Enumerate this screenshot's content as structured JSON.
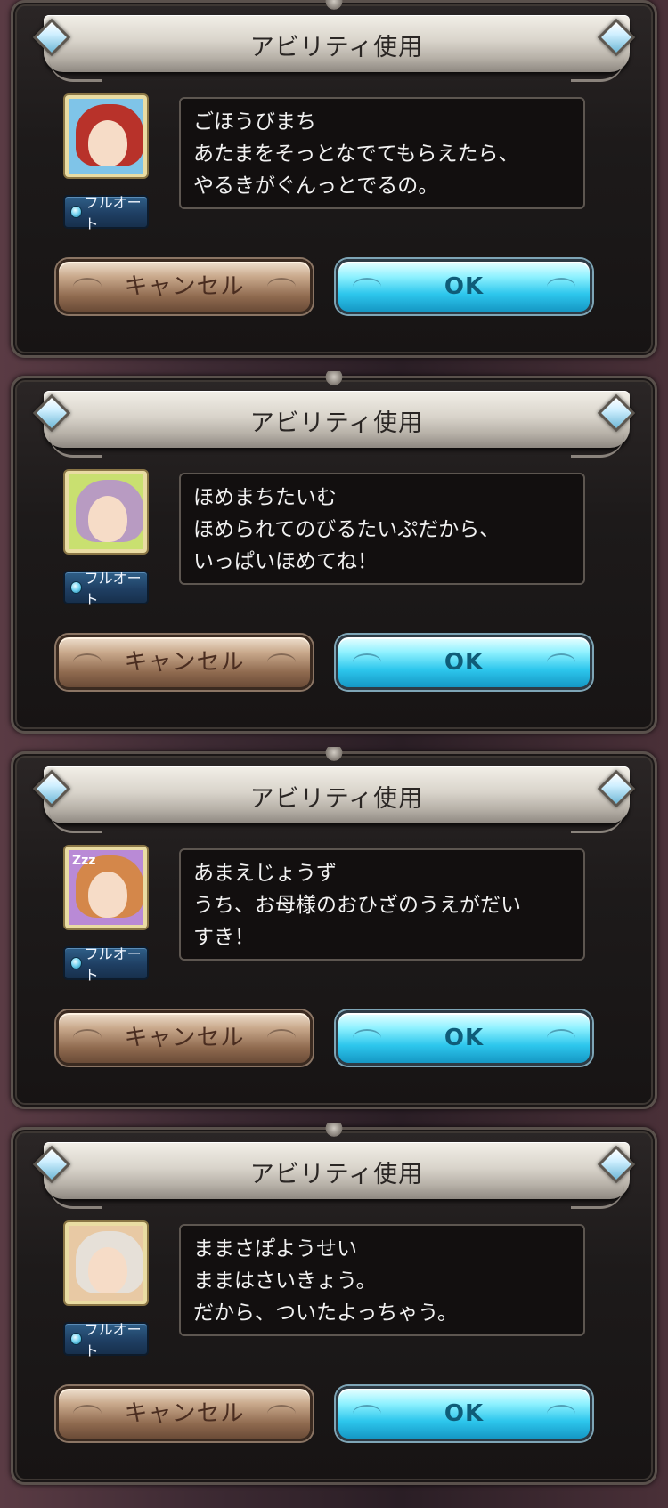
{
  "dialogs": [
    {
      "title": "アビリティ使用",
      "full_auto_label": "フルオート",
      "message_lines": [
        "ごほうびまち",
        "あたまをそっとなでてもらえたら、",
        "やるきがぐんっとでるの。"
      ],
      "cancel_label": "キャンセル",
      "ok_label": "OK",
      "avatar_bubble": "",
      "avatar_colors": {
        "bg": "#7fc4e8",
        "hair": "#b8322a"
      }
    },
    {
      "title": "アビリティ使用",
      "full_auto_label": "フルオート",
      "message_lines": [
        "ほめまちたいむ",
        "ほめられてのびるたいぷだから、",
        "いっぱいほめてね！"
      ],
      "cancel_label": "キャンセル",
      "ok_label": "OK",
      "avatar_bubble": "",
      "avatar_colors": {
        "bg": "#c9e070",
        "hair": "#b89bc2"
      }
    },
    {
      "title": "アビリティ使用",
      "full_auto_label": "フルオート",
      "message_lines": [
        "あまえじょうず",
        "うち、お母様のおひざのうえがだい",
        "すき！"
      ],
      "cancel_label": "キャンセル",
      "ok_label": "OK",
      "avatar_bubble": "Zzz",
      "avatar_colors": {
        "bg": "#b98ad6",
        "hair": "#d4874a"
      }
    },
    {
      "title": "アビリティ使用",
      "full_auto_label": "フルオート",
      "message_lines": [
        "ままさぽようせい",
        "ままはさいきょう。",
        "だから、ついたよっちゃう。"
      ],
      "cancel_label": "キャンセル",
      "ok_label": "OK",
      "avatar_bubble": "",
      "avatar_colors": {
        "bg": "#e8c9a4",
        "hair": "#e6e0d8"
      }
    }
  ]
}
